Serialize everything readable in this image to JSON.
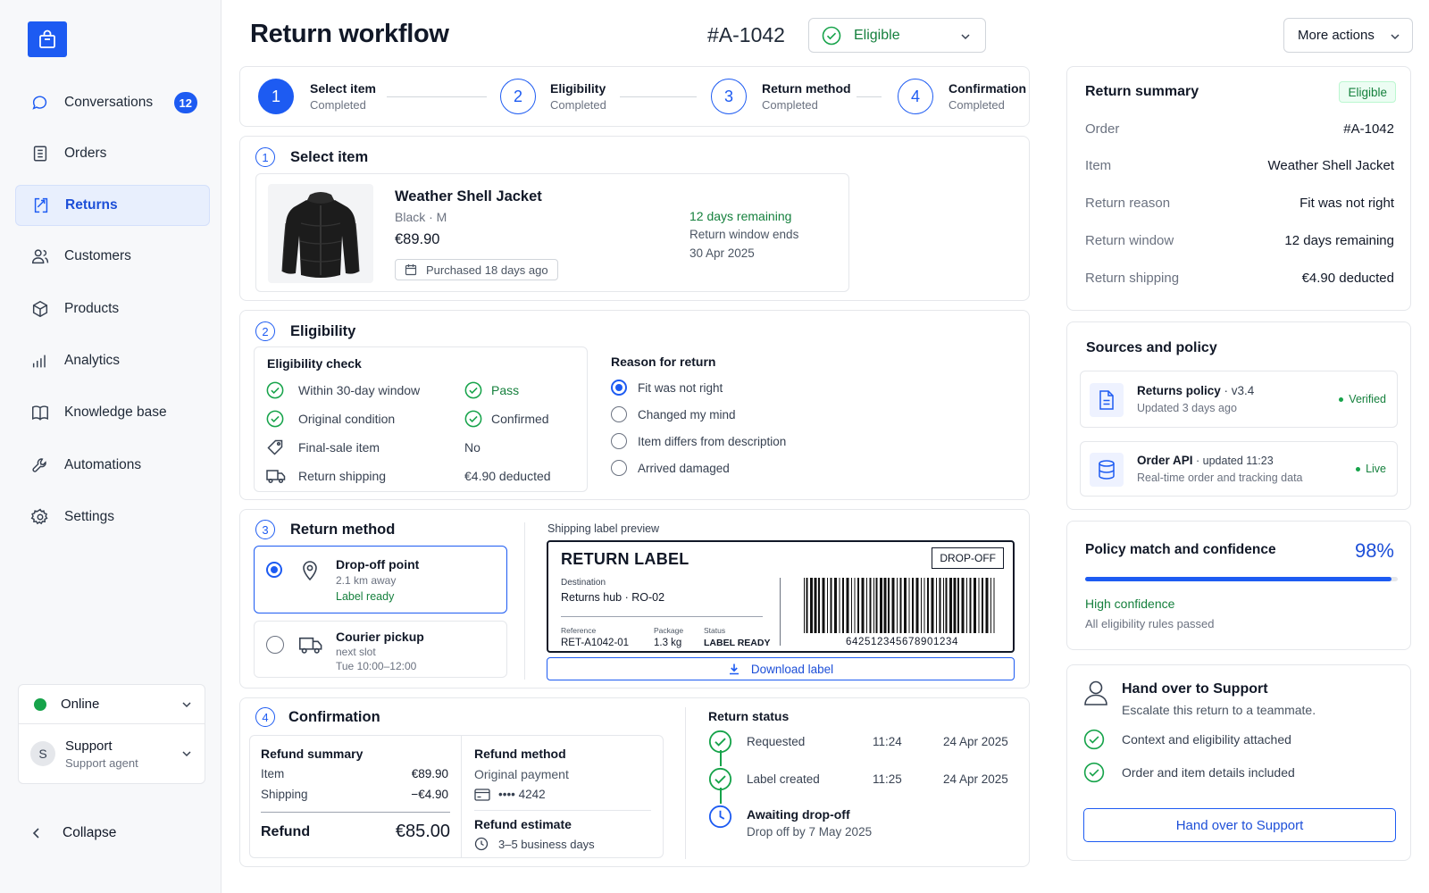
{
  "nav": {
    "items": [
      {
        "label": "Conversations",
        "icon": "chat-bubble-icon",
        "badge": "12"
      },
      {
        "label": "Orders",
        "icon": "clipboard-icon"
      },
      {
        "label": "Returns",
        "icon": "return-arrows-icon",
        "active": true
      },
      {
        "label": "Customers",
        "icon": "users-icon"
      },
      {
        "label": "Products",
        "icon": "box-icon"
      },
      {
        "label": "Analytics",
        "icon": "bar-chart-icon"
      },
      {
        "label": "Knowledge base",
        "icon": "book-icon"
      },
      {
        "label": "Automations",
        "icon": "wrench-icon"
      },
      {
        "label": "Settings",
        "icon": "gear-icon"
      }
    ],
    "status": "Online",
    "user_initial": "S",
    "user_name": "Support",
    "user_role": "Support agent",
    "collapse": "Collapse"
  },
  "header": {
    "title": "Return workflow",
    "order_id": "#A-1042",
    "status": "Eligible",
    "more_actions": "More actions"
  },
  "stepper": [
    {
      "n": "1",
      "label": "Select item",
      "state": "Completed"
    },
    {
      "n": "2",
      "label": "Eligibility",
      "state": "Completed"
    },
    {
      "n": "3",
      "label": "Return method",
      "state": "Completed"
    },
    {
      "n": "4",
      "label": "Confirmation",
      "state": "Completed"
    }
  ],
  "select_item": {
    "n": "1",
    "title": "Select item",
    "product_name": "Weather Shell Jacket",
    "variant": "Black · M",
    "price": "€89.90",
    "purchased": "Purchased 18 days ago",
    "days_remaining": "12 days remaining",
    "window_label": "Return window ends",
    "window_date": "30 Apr 2025"
  },
  "eligibility": {
    "n": "2",
    "title": "Eligibility",
    "check_title": "Eligibility check",
    "checks": [
      {
        "label": "Within 30-day window",
        "value": "Pass",
        "icon": "check-circle-icon"
      },
      {
        "label": "Original condition",
        "value": "Confirmed",
        "icon": "check-circle-icon"
      },
      {
        "label": "Final-sale item",
        "value": "No",
        "icon": "tag-icon"
      },
      {
        "label": "Return shipping",
        "value": "€4.90 deducted",
        "icon": "truck-icon"
      }
    ],
    "reason_title": "Reason for return",
    "reasons": [
      {
        "label": "Fit was not right",
        "selected": true
      },
      {
        "label": "Changed my mind",
        "selected": false
      },
      {
        "label": "Item differs from description",
        "selected": false
      },
      {
        "label": "Arrived damaged",
        "selected": false
      }
    ]
  },
  "return_method": {
    "n": "3",
    "title": "Return method",
    "options": [
      {
        "title": "Drop-off point",
        "sub": "2.1 km away",
        "note": "Label ready",
        "selected": true
      },
      {
        "title": "Courier pickup",
        "sub": "next slot",
        "note": "Tue 10:00–12:00",
        "selected": false
      }
    ],
    "preview_label": "Shipping label preview",
    "label": {
      "title": "RETURN LABEL",
      "tag": "DROP-OFF",
      "dest_label": "Destination",
      "dest_value": "Returns hub · RO-02",
      "ref_label": "Reference",
      "ref_value": "RET-A1042-01",
      "pkg_label": "Package",
      "pkg_value": "1.3 kg",
      "status_label": "Status",
      "status_value": "LABEL READY",
      "barcode": "642512345678901234"
    },
    "download": "Download label"
  },
  "confirmation": {
    "n": "4",
    "title": "Confirmation",
    "refund_summary_title": "Refund summary",
    "item_label": "Item",
    "item_value": "€89.90",
    "shipping_label": "Shipping",
    "shipping_value": "−€4.90",
    "refund_label": "Refund",
    "refund_value": "€85.00",
    "method_title": "Refund method",
    "method_value": "Original payment",
    "card": "•••• 4242",
    "estimate_title": "Refund estimate",
    "estimate_value": "3–5 business days",
    "status_title": "Return status",
    "timeline": [
      {
        "label": "Requested",
        "time": "11:24",
        "date": "24 Apr 2025"
      },
      {
        "label": "Label created",
        "time": "11:25",
        "date": "24 Apr 2025"
      }
    ],
    "awaiting": "Awaiting drop-off",
    "awaiting_sub": "Drop off by 7 May 2025"
  },
  "summary": {
    "title": "Return summary",
    "badge": "Eligible",
    "rows": [
      {
        "k": "Order",
        "v": "#A-1042"
      },
      {
        "k": "Item",
        "v": "Weather Shell Jacket"
      },
      {
        "k": "Return reason",
        "v": "Fit was not right"
      },
      {
        "k": "Return window",
        "v": "12 days remaining"
      },
      {
        "k": "Return shipping",
        "v": "€4.90 deducted"
      }
    ]
  },
  "sources": {
    "title": "Sources and policy",
    "items": [
      {
        "name": "Returns policy",
        "meta": " · v3.4",
        "sub": "Updated 3 days ago",
        "status": "Verified",
        "icon": "document-icon"
      },
      {
        "name": "Order API",
        "meta": " · updated 11:23",
        "sub": "Real-time order and tracking data",
        "status": "Live",
        "icon": "database-icon"
      }
    ]
  },
  "confidence": {
    "title": "Policy match and confidence",
    "value": "98%",
    "fraction": 0.98,
    "level": "High confidence",
    "note": "All eligibility rules passed"
  },
  "handover": {
    "title": "Hand over to Support",
    "sub": "Escalate this return to a teammate.",
    "checks": [
      "Context and eligibility attached",
      "Order and item details included"
    ],
    "button": "Hand over to Support"
  },
  "colors": {
    "accent": "#1d5bf2",
    "success": "#15803d",
    "border": "#e5e7eb"
  }
}
